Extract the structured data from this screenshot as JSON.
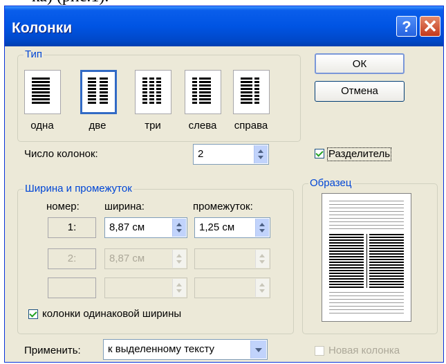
{
  "doc_text": "ка) (рис.1).",
  "window": {
    "title": "Колонки",
    "help": "?",
    "close": "✕"
  },
  "type_group": {
    "legend": "Тип",
    "presets": [
      {
        "label": "одна",
        "columns": 1,
        "selected": false
      },
      {
        "label": "две",
        "columns": 2,
        "selected": true
      },
      {
        "label": "три",
        "columns": 3,
        "selected": false
      },
      {
        "label": "слева",
        "columns": 2,
        "selected": false
      },
      {
        "label": "справа",
        "columns": 2,
        "selected": false
      }
    ]
  },
  "buttons": {
    "ok": "ОК",
    "cancel": "Отмена"
  },
  "num_columns": {
    "label": "Число колонок:",
    "value": "2"
  },
  "separator": {
    "label": "Разделитель",
    "checked": true
  },
  "width_group": {
    "legend": "Ширина и промежуток",
    "headers": {
      "number": "номер:",
      "width": "ширина:",
      "spacing": "промежуток:"
    },
    "rows": [
      {
        "number": "1:",
        "width": "8,87 см",
        "spacing": "1,25 см",
        "enabled": true
      },
      {
        "number": "2:",
        "width": "8,87 см",
        "spacing": "",
        "enabled": false
      },
      {
        "number": "",
        "width": "",
        "spacing": "",
        "enabled": false
      }
    ],
    "equal_width": {
      "label": "колонки одинаковой ширины",
      "checked": true
    }
  },
  "preview": {
    "legend": "Образец"
  },
  "apply": {
    "label": "Применить:",
    "value": "к выделенному тексту"
  },
  "new_column": {
    "label": "Новая колонка",
    "checked": false,
    "enabled": false
  }
}
